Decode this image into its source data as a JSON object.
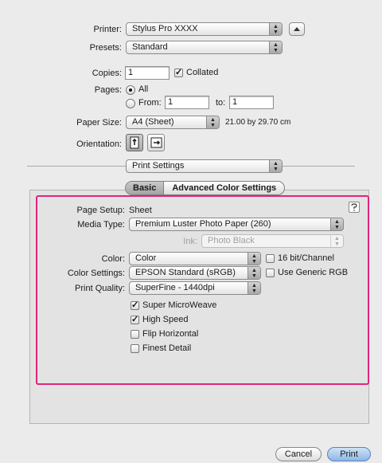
{
  "printer": {
    "label": "Printer:",
    "value": "Stylus Pro XXXX"
  },
  "presets": {
    "label": "Presets:",
    "value": "Standard"
  },
  "copies": {
    "label": "Copies:",
    "value": "1",
    "collated_label": "Collated",
    "collated_checked": true
  },
  "pages": {
    "label": "Pages:",
    "all_label": "All",
    "from_label": "From:",
    "from_value": "1",
    "to_label": "to:",
    "to_value": "1",
    "selected": "All"
  },
  "paper_size": {
    "label": "Paper Size:",
    "value": "A4 (Sheet)",
    "dimensions": "21.00 by 29.70 cm"
  },
  "orientation": {
    "label": "Orientation:",
    "selected": "portrait"
  },
  "section_popup": {
    "value": "Print Settings"
  },
  "tabs": [
    {
      "label": "Basic",
      "selected": true
    },
    {
      "label": "Advanced Color Settings",
      "selected": false
    }
  ],
  "settings": {
    "page_setup_label": "Page Setup:",
    "page_setup_value": "Sheet",
    "media_type_label": "Media Type:",
    "media_type_value": "Premium Luster Photo Paper (260)",
    "ink_label": "Ink:",
    "ink_value": "Photo Black",
    "color_label": "Color:",
    "color_value": "Color",
    "bit16_label": "16 bit/Channel",
    "bit16_checked": false,
    "color_settings_label": "Color Settings:",
    "color_settings_value": "EPSON Standard (sRGB)",
    "generic_rgb_label": "Use Generic RGB",
    "generic_rgb_checked": false,
    "print_quality_label": "Print Quality:",
    "print_quality_value": "SuperFine - 1440dpi",
    "options": [
      {
        "label": "Super MicroWeave",
        "checked": true
      },
      {
        "label": "High Speed",
        "checked": true
      },
      {
        "label": "Flip Horizontal",
        "checked": false
      },
      {
        "label": "Finest Detail",
        "checked": false
      }
    ]
  },
  "buttons": {
    "cancel": "Cancel",
    "print": "Print"
  },
  "colors": {
    "highlight": "#e0267c",
    "window_bg": "#ebebeb"
  },
  "icons": {
    "help": "help-icon",
    "disclosure": "disclosure-triangle-icon",
    "portrait": "portrait-orientation-icon",
    "landscape": "landscape-orientation-icon"
  }
}
